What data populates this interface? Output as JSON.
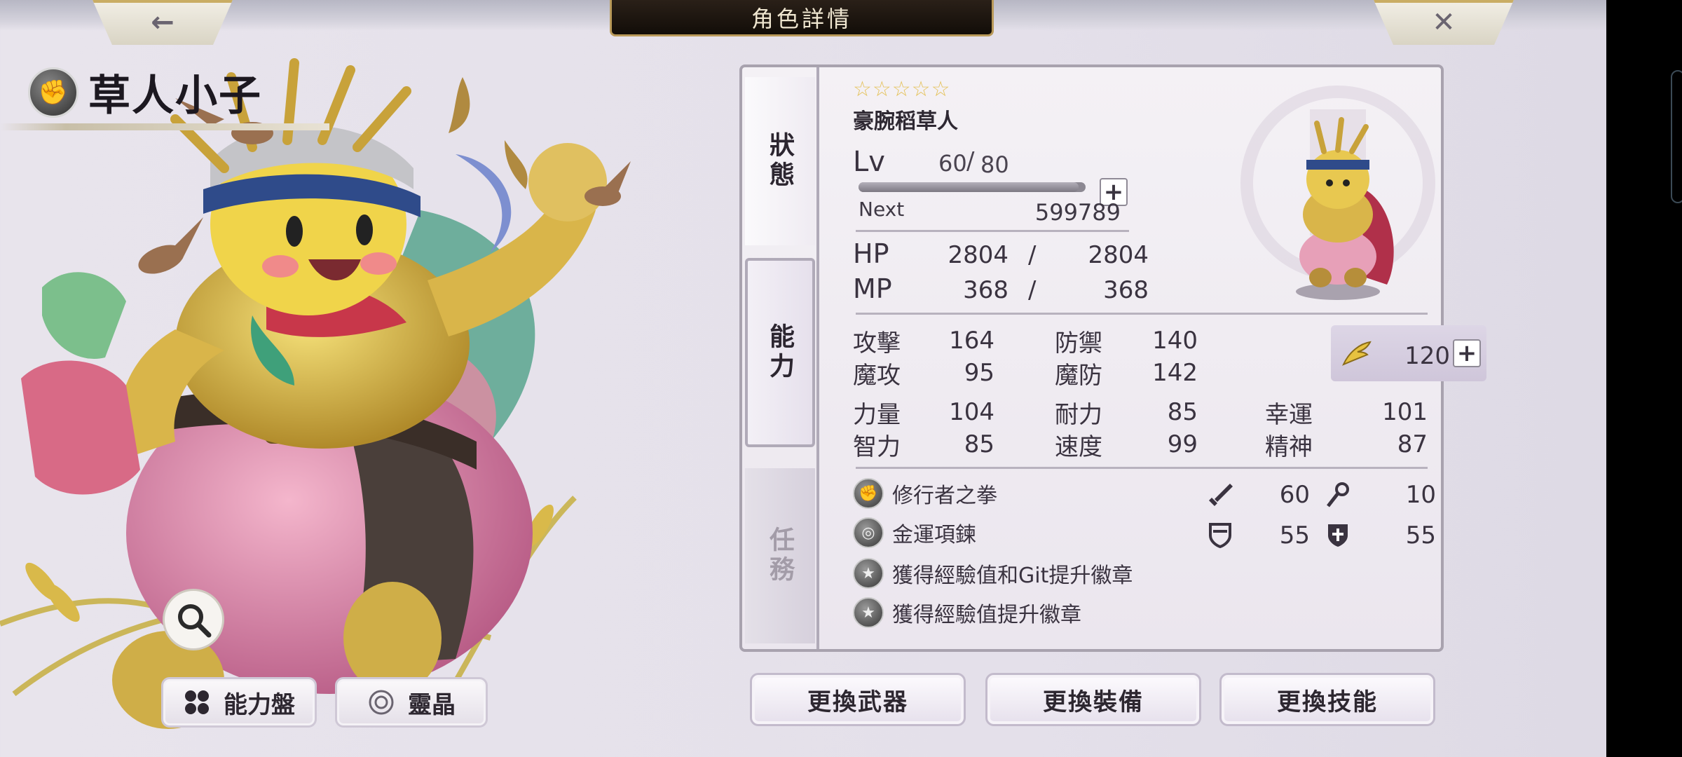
{
  "header": {
    "title": "角色詳情",
    "back_icon": "←",
    "close_icon": "✕"
  },
  "character": {
    "name": "草人小子",
    "class_icon": "fist-icon"
  },
  "bottom_left": {
    "ability_board_label": "能力盤",
    "spirit_crystal_label": "靈晶"
  },
  "tabs": {
    "status": "狀態",
    "ability": "能力",
    "quest": "任務"
  },
  "status": {
    "rarity_stars": "☆☆☆☆☆",
    "subname": "豪腕稻草人",
    "lv_label": "Lv",
    "lv_current": "60",
    "lv_separator": "/",
    "lv_max": "80",
    "exp_fraction": 0.97,
    "next_label": "Next",
    "next_value": "599789",
    "hp_label": "HP",
    "hp_current": "2804",
    "hp_max": "2804",
    "mp_label": "MP",
    "mp_current": "368",
    "mp_max": "368",
    "slash": "/"
  },
  "stats": {
    "atk_label": "攻擊",
    "atk": "164",
    "def_label": "防禦",
    "def": "140",
    "matk_label": "魔攻",
    "matk": "95",
    "mdef_label": "魔防",
    "mdef": "142",
    "speed_value": "120",
    "str_label": "力量",
    "str": "104",
    "end_label": "耐力",
    "end": "85",
    "luk_label": "幸運",
    "luk": "101",
    "int_label": "智力",
    "int": "85",
    "spd_label": "速度",
    "spd": "99",
    "spi_label": "精神",
    "spi": "87"
  },
  "equipment": {
    "weapon": "修行者之拳",
    "accessory": "金運項鍊",
    "badge1": "獲得經驗值和Git提升徽章",
    "badge2": "獲得經驗值提升徽章",
    "phys_atk": "60",
    "mag_atk": "10",
    "phys_def": "55",
    "mag_def": "55"
  },
  "actions": {
    "change_weapon": "更換武器",
    "change_equipment": "更換裝備",
    "change_skill": "更換技能"
  }
}
